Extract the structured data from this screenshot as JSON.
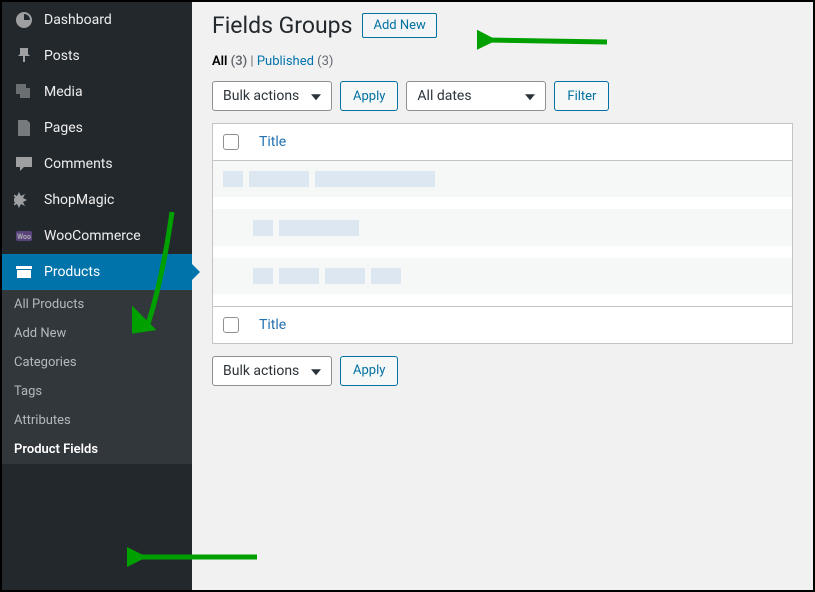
{
  "sidebar": {
    "items": [
      {
        "label": "Dashboard"
      },
      {
        "label": "Posts"
      },
      {
        "label": "Media"
      },
      {
        "label": "Pages"
      },
      {
        "label": "Comments"
      },
      {
        "label": "ShopMagic"
      },
      {
        "label": "WooCommerce"
      },
      {
        "label": "Products"
      }
    ],
    "sub": [
      {
        "label": "All Products"
      },
      {
        "label": "Add New"
      },
      {
        "label": "Categories"
      },
      {
        "label": "Tags"
      },
      {
        "label": "Attributes"
      },
      {
        "label": "Product Fields"
      }
    ]
  },
  "header": {
    "title": "Fields Groups",
    "add_new": "Add New"
  },
  "filters": {
    "all_label": "All",
    "all_count": "(3)",
    "published_label": "Published",
    "published_count": "(3)",
    "separator": " | "
  },
  "tablenav": {
    "bulk_actions": "Bulk actions",
    "apply": "Apply",
    "all_dates": "All dates",
    "filter": "Filter"
  },
  "table": {
    "title_col": "Title"
  }
}
